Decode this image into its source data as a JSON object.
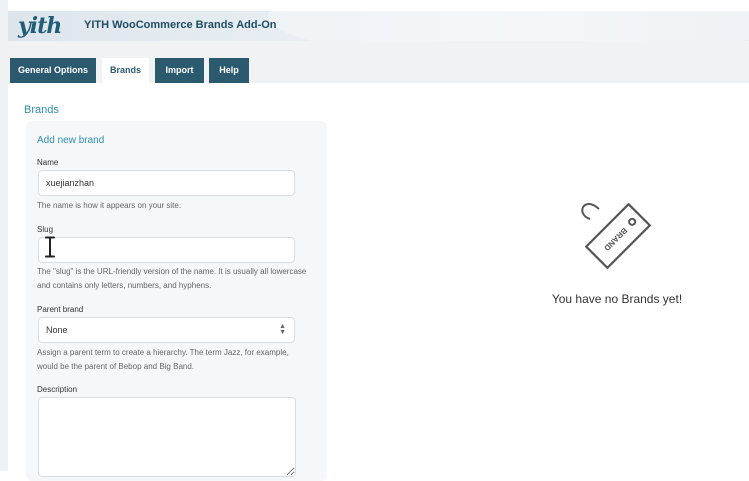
{
  "header": {
    "logo_text": "yith",
    "plugin_title": "YITH WooCommerce Brands Add-On"
  },
  "tabs": [
    {
      "label": "General Options",
      "active": false
    },
    {
      "label": "Brands",
      "active": true
    },
    {
      "label": "Import",
      "active": false
    },
    {
      "label": "Help",
      "active": false
    }
  ],
  "main": {
    "section_title": "Brands",
    "form": {
      "title": "Add new brand",
      "name": {
        "label": "Name",
        "value": "xuejianzhan",
        "help": "The name is how it appears on your site."
      },
      "slug": {
        "label": "Slug",
        "value": "",
        "help": "The \"slug\" is the URL-friendly version of the name. It is usually all lowercase and contains only letters, numbers, and hyphens."
      },
      "parent": {
        "label": "Parent brand",
        "value": "None",
        "help": "Assign a parent term to create a hierarchy. The term Jazz, for example, would be the parent of Bebop and Big Band."
      },
      "description": {
        "label": "Description",
        "value": ""
      }
    },
    "empty_state": {
      "tag_text": "BRAND",
      "message": "You have no Brands yet!",
      "icon": "brand-tag-icon"
    }
  },
  "colors": {
    "tab_bg": "#2b5a6f",
    "accent": "#2e8fb0",
    "panel_bg": "#f6f7f9"
  }
}
